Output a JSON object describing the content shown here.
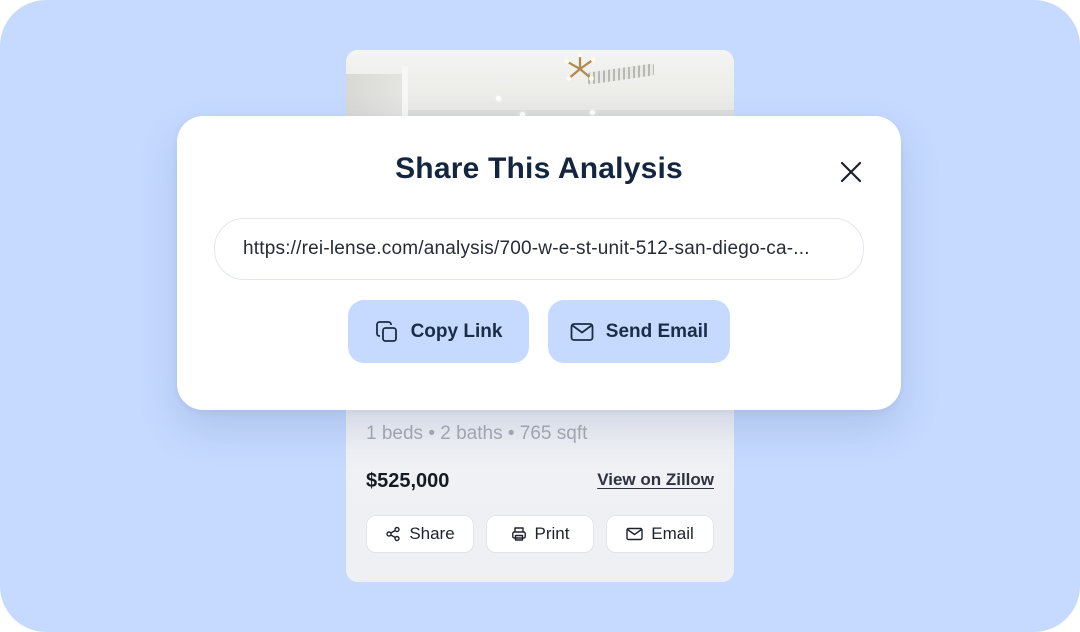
{
  "card": {
    "details": "1 beds • 2 baths • 765 sqft",
    "price": "$525,000",
    "zillow_link": "View on Zillow",
    "actions": {
      "share": "Share",
      "print": "Print",
      "email": "Email"
    }
  },
  "modal": {
    "title": "Share This Analysis",
    "url_value": "https://rei-lense.com/analysis/700-w-e-st-unit-512-san-diego-ca-...",
    "copy_link_label": "Copy Link",
    "send_email_label": "Send Email"
  },
  "colors": {
    "background": "#c6daff",
    "button_accent": "#c6daff",
    "title": "#14263f"
  },
  "icons": {
    "close": "close-icon",
    "copy": "copy-icon",
    "mail": "mail-icon",
    "share": "share-icon",
    "print": "printer-icon"
  }
}
